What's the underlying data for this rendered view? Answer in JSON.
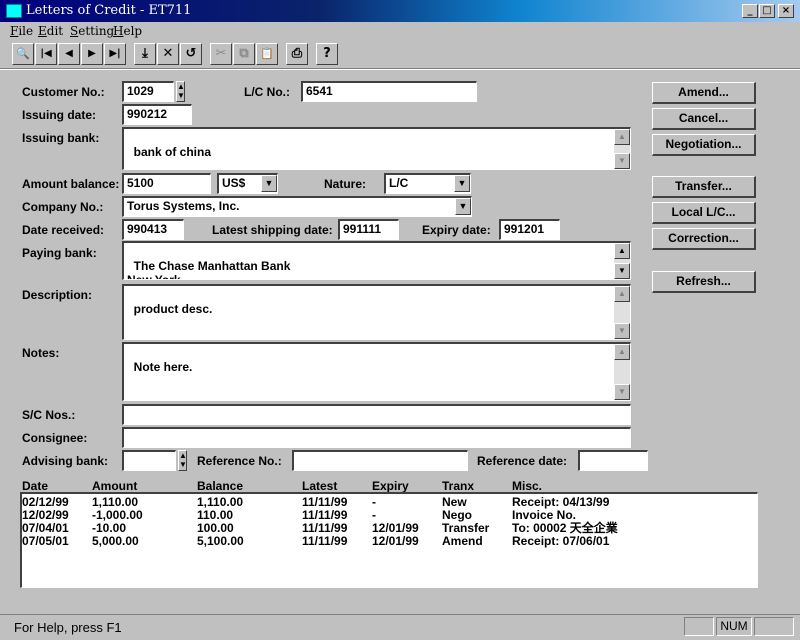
{
  "window": {
    "title": "Letters of Credit - ET711",
    "min": "_",
    "max": "□",
    "close": "×"
  },
  "menu": [
    {
      "key": "F",
      "rest": "ile"
    },
    {
      "key": "E",
      "rest": "dit"
    },
    {
      "key": "S",
      "rest": "etting"
    },
    {
      "key": "H",
      "rest": "elp"
    }
  ],
  "toolbar": {
    "find": "🔍",
    "first": "|◀",
    "prev": "◀",
    "next": "▶",
    "last": "▶|",
    "save": "⤓",
    "delete": "✕",
    "undo": "↺",
    "cut": "✂",
    "copy": "⧉",
    "paste": "📋",
    "print": "⎙",
    "help": "?"
  },
  "form": {
    "customer_no_label": "Customer No.:",
    "customer_no": "1029",
    "lc_no_label": "L/C No.:",
    "lc_no": "6541",
    "issuing_date_label": "Issuing date:",
    "issuing_date": "990212",
    "issuing_bank_label": "Issuing bank:",
    "issuing_bank": "bank of china",
    "amount_balance_label": "Amount balance:",
    "amount_balance": "5100",
    "currency": "US$",
    "nature_label": "Nature:",
    "nature": "L/C",
    "company_no_label": "Company No.:",
    "company": "Torus Systems, Inc.",
    "date_received_label": "Date received:",
    "date_received": "990413",
    "latest_shipping_label": "Latest shipping date:",
    "latest_shipping": "991111",
    "expiry_label": "Expiry date:",
    "expiry": "991201",
    "paying_bank_label": "Paying bank:",
    "paying_bank": "The Chase Manhattan Bank\nNew York",
    "description_label": "Description:",
    "description": "product desc.",
    "notes_label": "Notes:",
    "notes": "Note here.",
    "sc_nos_label": "S/C Nos.:",
    "sc_nos": "",
    "consignee_label": "Consignee:",
    "consignee": "",
    "advising_bank_label": "Advising bank:",
    "advising_bank": "",
    "reference_no_label": "Reference No.:",
    "reference_no": "",
    "reference_date_label": "Reference date:",
    "reference_date": ""
  },
  "buttons": {
    "amend": "Amend...",
    "cancel": "Cancel...",
    "negotiation": "Negotiation...",
    "transfer": "Transfer...",
    "local_lc": "Local L/C...",
    "correction": "Correction...",
    "refresh": "Refresh..."
  },
  "history": {
    "columns": [
      "Date",
      "Amount",
      "Balance",
      "Latest",
      "Expiry",
      "Tranx",
      "Misc."
    ],
    "rows": [
      [
        "02/12/99",
        "1,110.00",
        "1,110.00",
        "11/11/99",
        "-",
        "New",
        "Receipt: 04/13/99"
      ],
      [
        "12/02/99",
        "-1,000.00",
        "110.00",
        "11/11/99",
        "-",
        "Nego",
        "Invoice No."
      ],
      [
        "07/04/01",
        "-10.00",
        "100.00",
        "11/11/99",
        "12/01/99",
        "Transfer",
        "To: 00002 天全企業"
      ],
      [
        "07/05/01",
        "5,000.00",
        "5,100.00",
        "11/11/99",
        "12/01/99",
        "Amend",
        "Receipt: 07/06/01"
      ]
    ]
  },
  "status": {
    "text": "For Help, press F1",
    "num": "NUM"
  }
}
